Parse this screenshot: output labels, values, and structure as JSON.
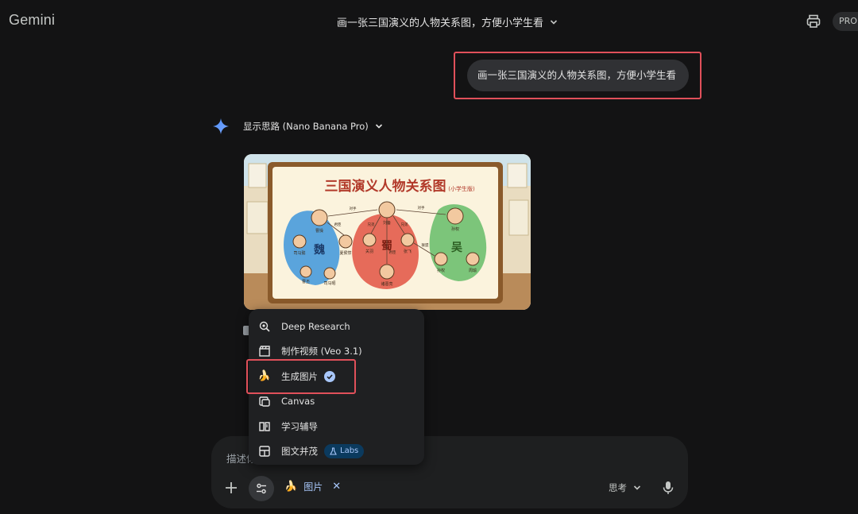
{
  "header": {
    "brand": "Gemini",
    "conversation_title": "画一张三国演义的人物关系图，方便小学生看",
    "pro_label": "PRO",
    "icons": [
      "chevron-down-icon",
      "printer-icon"
    ]
  },
  "chat": {
    "user_message": "画一张三国演义的人物关系图，方便小学生看",
    "thinking_label": "显示思路 (Nano Banana Pro)",
    "generated_image": {
      "title": "三国演义人物关系图",
      "subtitle": "(小学生版)",
      "kingdoms": [
        "魏",
        "蜀",
        "吴"
      ],
      "characters": [
        "曹操",
        "刘备",
        "孙权",
        "司马懿",
        "夏侯惇",
        "关羽",
        "张飞",
        "诸葛亮",
        "孙权",
        "周瑜",
        "曹丕",
        "司马昭"
      ],
      "relations": [
        "对手",
        "对手",
        "兄弟",
        "兄弟",
        "君臣",
        "君臣",
        "联盟"
      ]
    }
  },
  "tools_menu": {
    "items": [
      {
        "label": "Deep Research",
        "icon": "deep-research-icon"
      },
      {
        "label": "制作视频 (Veo 3.1)",
        "icon": "video-clapper-icon"
      },
      {
        "label": "生成图片",
        "icon": "banana-icon",
        "selected": true
      },
      {
        "label": "Canvas",
        "icon": "canvas-icon"
      },
      {
        "label": "学习辅导",
        "icon": "book-icon"
      },
      {
        "label": "图文并茂",
        "icon": "layout-icon",
        "badge": "Labs"
      }
    ]
  },
  "composer": {
    "placeholder": "描述你",
    "active_tool_chip": "图片",
    "mode_label": "思考"
  },
  "colors": {
    "background": "#131314",
    "surface": "#1e1f20",
    "accent": "#a8c7fa",
    "highlight_box": "#e0505a"
  }
}
